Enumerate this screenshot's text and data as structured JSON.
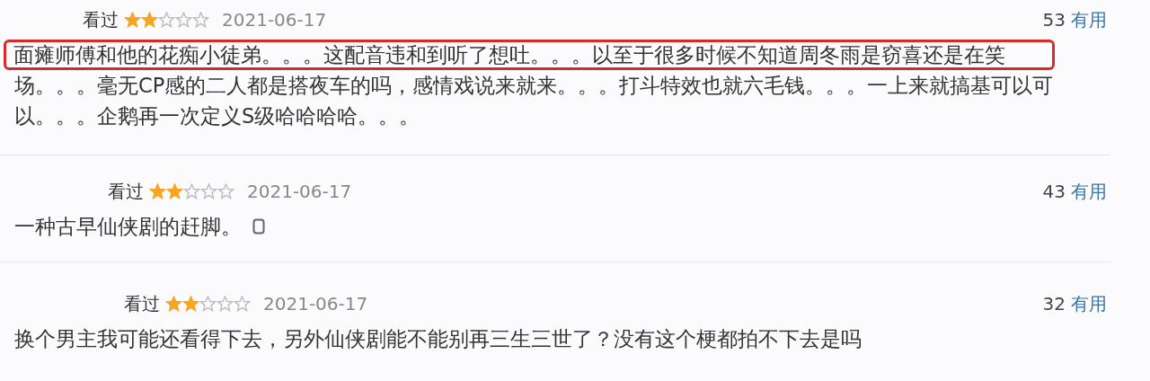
{
  "comments": [
    {
      "status": "看过",
      "stars": 2,
      "date": "2021-06-17",
      "votes": "53",
      "vote_label": "有用",
      "lines": [
        {
          "text": "面瘫师傅和他的花痴小徒弟。。。这配音违和到听了想吐。。。以至于很多时候不知道周冬雨是窃喜还是在笑",
          "highlighted": true
        },
        {
          "text": "场。。。毫无CP感的二人都是搭夜车的吗，感情戏说来就来。。。打斗特效也就六毛钱。。。一上来就搞基可以可",
          "highlighted": false
        },
        {
          "text": "以。。。企鹅再一次定义S级哈哈哈哈。。。",
          "highlighted": false
        }
      ],
      "emoji": false
    },
    {
      "status": "看过",
      "stars": 2,
      "date": "2021-06-17",
      "votes": "43",
      "vote_label": "有用",
      "lines": [
        {
          "text": "一种古早仙侠剧的赶脚。",
          "highlighted": false
        }
      ],
      "emoji": true
    },
    {
      "status": "看过",
      "stars": 2,
      "date": "2021-06-17",
      "votes": "32",
      "vote_label": "有用",
      "lines": [
        {
          "text": "换个男主我可能还看得下去，另外仙侠剧能不能别再三生三世了？没有这个梗都拍不下去是吗",
          "highlighted": false
        }
      ],
      "emoji": false
    }
  ]
}
